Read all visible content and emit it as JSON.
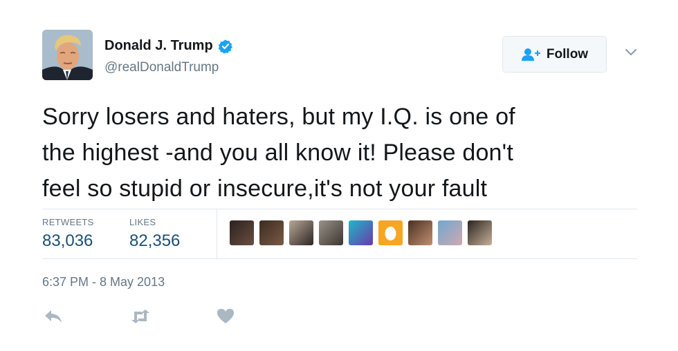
{
  "author": {
    "name": "Donald J. Trump",
    "handle": "@realDonaldTrump",
    "verified": true
  },
  "follow_button": {
    "label": "Follow",
    "icon": "follow-user-icon"
  },
  "tweet": {
    "lines": [
      "Sorry losers and haters, but my I.Q. is one of",
      "the highest -and you all know it! Please don't",
      "feel so stupid or insecure,it's not your fault"
    ]
  },
  "stats": {
    "retweets_label": "RETWEETS",
    "retweets_value": "83,036",
    "likes_label": "LIKES",
    "likes_value": "82,356"
  },
  "liker_avatars": [
    {
      "colors": [
        "#2a2220",
        "#6b4e40"
      ]
    },
    {
      "colors": [
        "#3a2c22",
        "#7b5a44"
      ]
    },
    {
      "colors": [
        "#b8a898",
        "#2d2522"
      ]
    },
    {
      "colors": [
        "#9a9288",
        "#3c3530"
      ]
    },
    {
      "colors": [
        "#1fb8c8",
        "#6a3aa8"
      ]
    },
    {
      "colors": [
        "#f5a623",
        "#f7b53c"
      ]
    },
    {
      "colors": [
        "#4a3022",
        "#c09070"
      ]
    },
    {
      "colors": [
        "#6fa8d0",
        "#d0a8b0"
      ]
    },
    {
      "colors": [
        "#2a2420",
        "#c8b098"
      ]
    }
  ],
  "timestamp": "6:37 PM - 8 May 2013",
  "actions": [
    "reply-icon",
    "retweet-icon",
    "like-heart-icon"
  ],
  "colors": {
    "accent": "#1da1f2",
    "stat_value": "#1b4f74",
    "muted": "#657786",
    "action_icon": "#aab8c2"
  }
}
